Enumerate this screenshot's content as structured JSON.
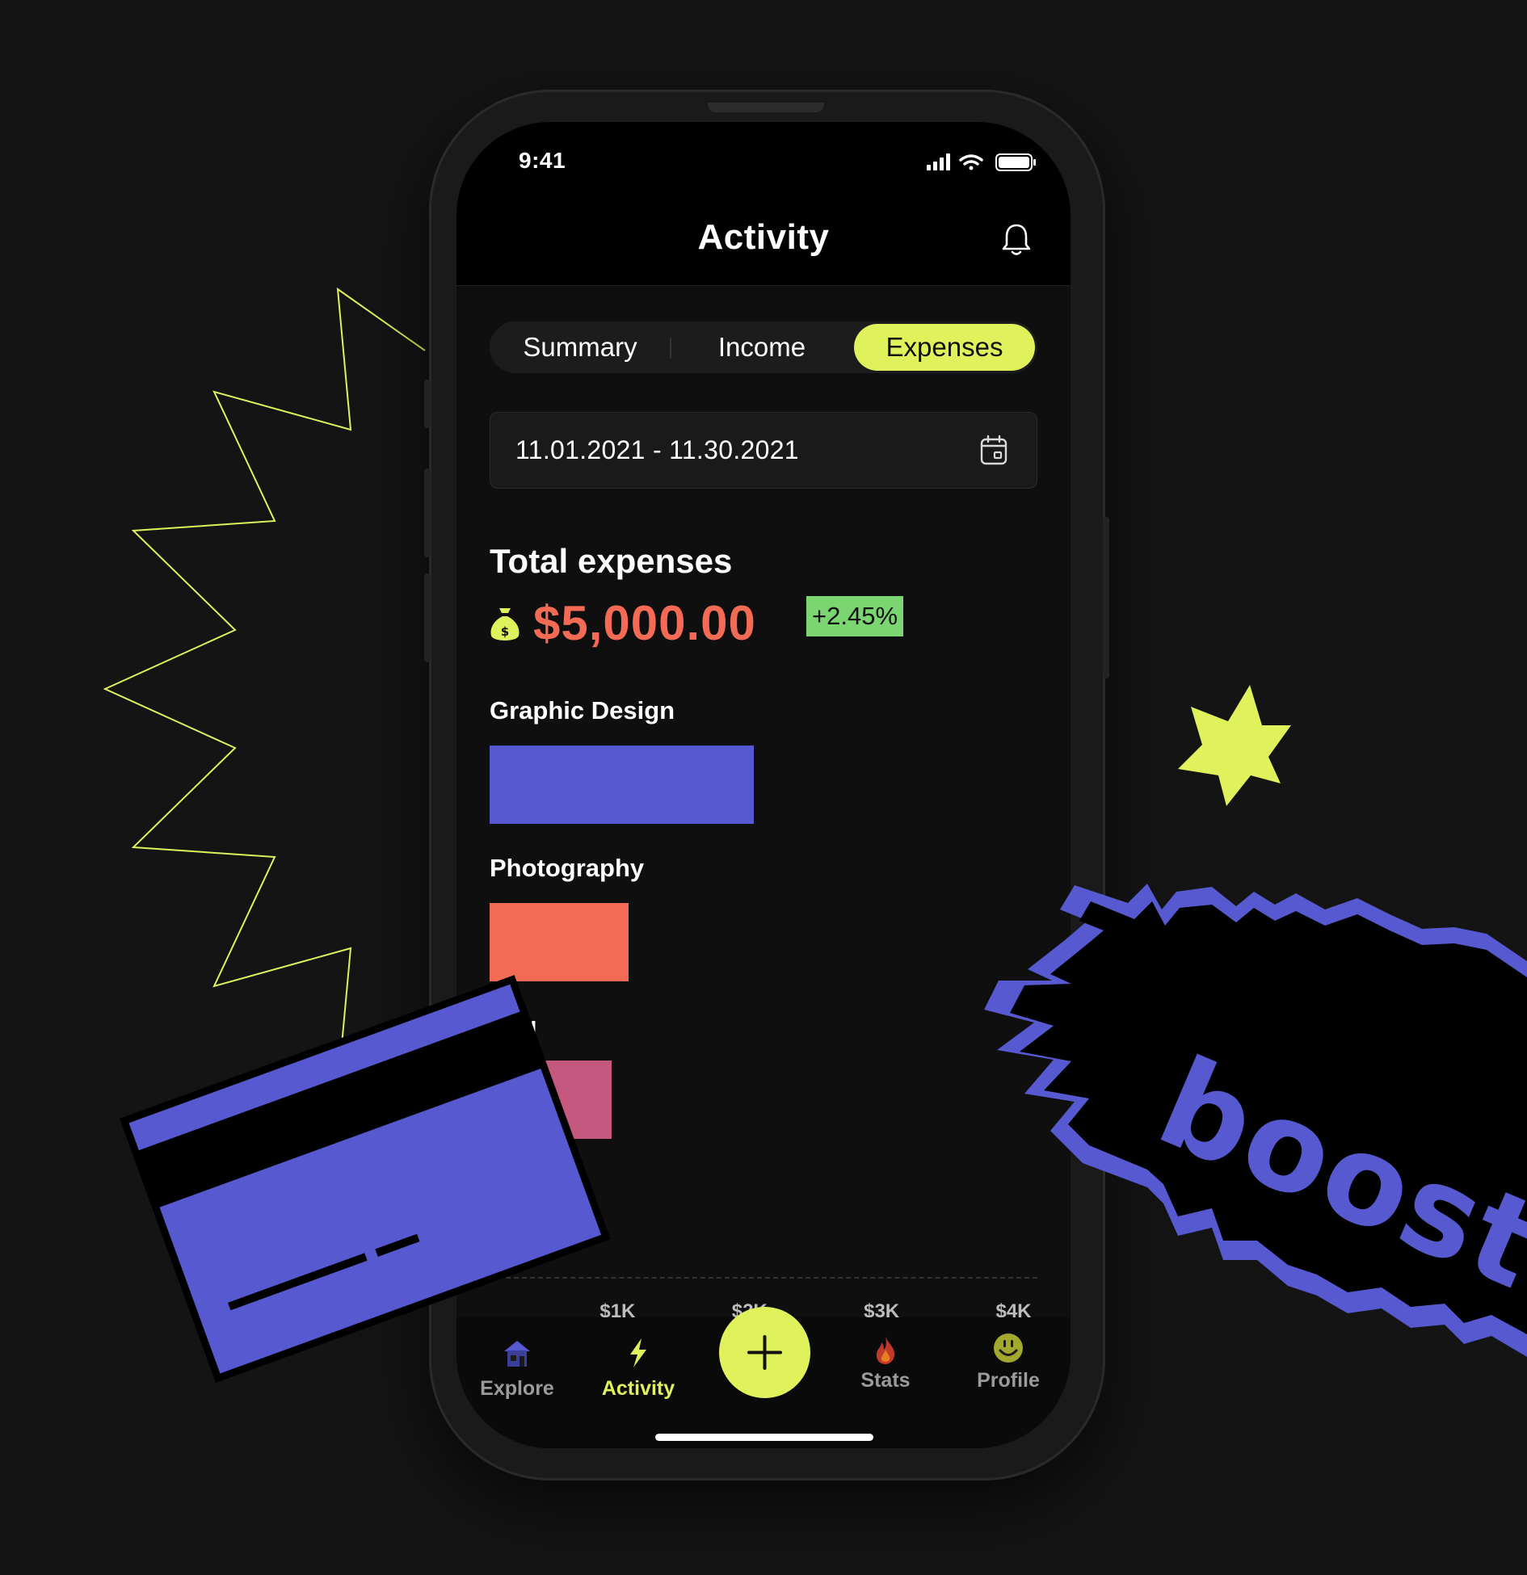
{
  "status_bar": {
    "time": "9:41"
  },
  "header": {
    "title": "Activity"
  },
  "tabs": [
    {
      "label": "Summary",
      "active": false
    },
    {
      "label": "Income",
      "active": false
    },
    {
      "label": "Expenses",
      "active": true
    }
  ],
  "date_range": {
    "value": "11.01.2021 - 11.30.2021"
  },
  "summary": {
    "title": "Total expenses",
    "amount": "$5,000.00",
    "change": "+2.45%"
  },
  "chart_data": {
    "type": "bar",
    "orientation": "horizontal",
    "categories": [
      "Graphic Design",
      "Photography",
      "ring"
    ],
    "values": [
      2000,
      1050,
      925
    ],
    "colors": [
      "#5659cf",
      "#f36b55",
      "#c4587e"
    ],
    "xticks": [
      "$1K",
      "$2K",
      "$3K",
      "$4K"
    ],
    "xlim": [
      0,
      4150
    ]
  },
  "bottom_nav": {
    "items": [
      {
        "label": "Explore",
        "icon": "house-icon",
        "active": false
      },
      {
        "label": "Activity",
        "icon": "lightning-icon",
        "active": true
      },
      {
        "label": "Stats",
        "icon": "fire-icon",
        "active": false
      },
      {
        "label": "Profile",
        "icon": "smiley-icon",
        "active": false
      }
    ],
    "add_icon": "plus-icon"
  },
  "sticker": {
    "text": "boost"
  },
  "colors": {
    "accent": "#dff15b",
    "brand_blue": "#5659cf",
    "expense_red": "#f36b55",
    "positive_green": "#7bd672"
  }
}
